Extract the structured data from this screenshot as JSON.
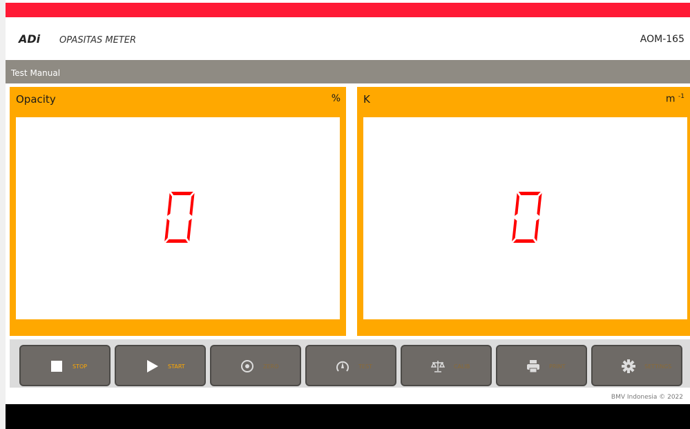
{
  "header": {
    "brand": "ADi",
    "title": "OPASITAS METER",
    "model": "AOM-165"
  },
  "mode": {
    "label": "Test Manual"
  },
  "panels": {
    "opacity": {
      "label": "Opacity",
      "unit": "%",
      "value": "0"
    },
    "k": {
      "label": "K",
      "unit": "m",
      "unit_exp": "-1",
      "value": "0"
    }
  },
  "buttons": [
    {
      "label": "STOP",
      "icon": "stop-icon",
      "enabled": true
    },
    {
      "label": "START",
      "icon": "play-icon",
      "enabled": true
    },
    {
      "label": "ZERO",
      "icon": "zero-icon",
      "enabled": false
    },
    {
      "label": "TEST",
      "icon": "gauge-icon",
      "enabled": false
    },
    {
      "label": "CALIB",
      "icon": "scale-icon",
      "enabled": false
    },
    {
      "label": "PRINT",
      "icon": "printer-icon",
      "enabled": false
    },
    {
      "label": "SETTINGS",
      "icon": "gear-icon",
      "enabled": false
    }
  ],
  "footer": {
    "copyright": "BMV Indonesia © 2022"
  },
  "colors": {
    "top_bar": "#ff1a35",
    "panel": "#ffa800",
    "segment": "#ff0000",
    "mode_bar": "#8f8b83",
    "button": "#6e6a66"
  }
}
